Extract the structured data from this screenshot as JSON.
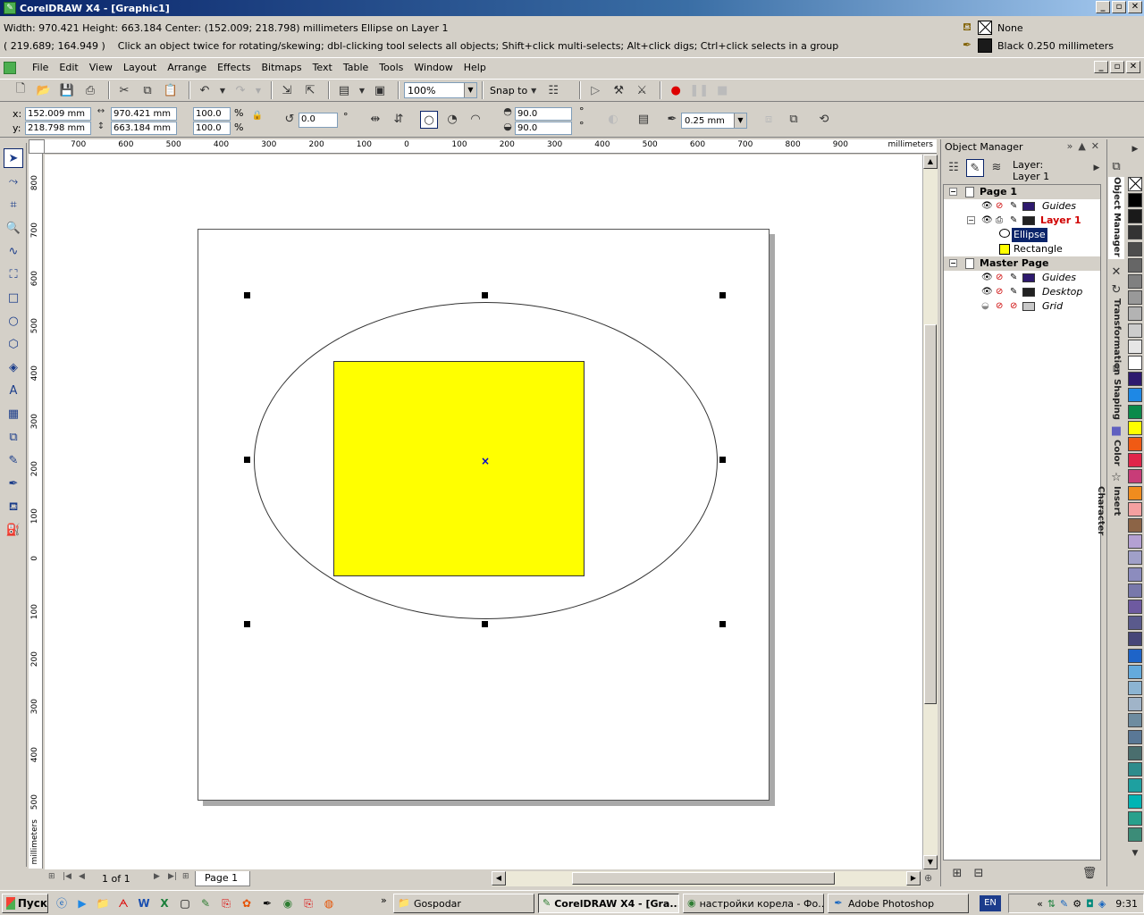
{
  "window": {
    "title": "CorelDRAW X4 - [Graphic1]",
    "buttons": [
      "_",
      "▫",
      "✕"
    ]
  },
  "status": {
    "dimensions": "Width: 970.421  Height: 663.184  Center: (152.009; 218.798)  millimeters",
    "object": "Ellipse on Layer 1",
    "cursor": "( 219.689; 164.949 )",
    "hint": "Click an object twice for rotating/skewing; dbl-clicking tool selects all objects; Shift+click multi-selects; Alt+click digs; Ctrl+click selects in a group",
    "fill_label": "None",
    "outline_label": "Black  0.250 millimeters"
  },
  "menu": [
    "File",
    "Edit",
    "View",
    "Layout",
    "Arrange",
    "Effects",
    "Bitmaps",
    "Text",
    "Table",
    "Tools",
    "Window",
    "Help"
  ],
  "toolbar": {
    "zoom": "100%",
    "snap_to": "Snap to"
  },
  "properties": {
    "x_label": "x:",
    "y_label": "y:",
    "x": "152.009 mm",
    "y": "218.798 mm",
    "width": "970.421 mm",
    "height": "663.184 mm",
    "scale_x": "100.0",
    "scale_y": "100.0",
    "percent": "%",
    "rotation": "0.0",
    "degree": "°",
    "start_angle": "90.0",
    "end_angle": "90.0",
    "outline_width": "0.25 mm"
  },
  "rulers": {
    "unit": "millimeters",
    "h_ticks": [
      "700",
      "600",
      "500",
      "400",
      "300",
      "200",
      "100",
      "0",
      "100",
      "200",
      "300",
      "400",
      "500",
      "600",
      "700",
      "800",
      "900"
    ],
    "v_ticks": [
      "800",
      "700",
      "600",
      "500",
      "400",
      "300",
      "200",
      "100",
      "0",
      "100",
      "200",
      "300",
      "400",
      "500"
    ]
  },
  "navigator": {
    "count": "1 of 1",
    "page_tab": "Page 1"
  },
  "object_manager": {
    "title": "Object Manager",
    "layer_label": "Layer:",
    "layer_value": "Layer 1",
    "page1": "Page 1",
    "guides": "Guides",
    "layer1": "Layer 1",
    "ellipse": "Ellipse",
    "rectangle": "Rectangle",
    "master_page": "Master Page",
    "master_guides": "Guides",
    "desktop": "Desktop",
    "grid": "Grid"
  },
  "docker_tabs": [
    "Object Manager",
    "Transformation",
    "Shaping",
    "Color",
    "Insert Character"
  ],
  "palette": [
    "#000000",
    "#1a1a1a",
    "#333333",
    "#4d4d4d",
    "#666666",
    "#808080",
    "#999999",
    "#b3b3b3",
    "#cccccc",
    "#e6e6e6",
    "#ffffff",
    "#2e1a6e",
    "#1e88e5",
    "#0b8a4a",
    "#ffff00",
    "#f05a14",
    "#e0254a",
    "#c83c78",
    "#f08c1e",
    "#f4a0a0",
    "#8c6446",
    "#b4a0d2",
    "#a0a0c8",
    "#8c8cbe",
    "#7878aa",
    "#6e5aa0",
    "#5a5a8c",
    "#464678",
    "#1e64c8",
    "#64aadc",
    "#8cb4d2",
    "#a0b4c8",
    "#6e8ca0",
    "#5a7896",
    "#4a6e6e",
    "#2e8c8c",
    "#1ea0a0",
    "#00b4b4",
    "#28a08c",
    "#3c8c78"
  ],
  "taskbar": {
    "start": "Пуск",
    "tasks": [
      "Gospodar",
      "CorelDRAW X4 - [Gra...",
      "настройки корела - Фо...",
      "Adobe Photoshop"
    ],
    "lang": "EN",
    "time": "9:31"
  }
}
